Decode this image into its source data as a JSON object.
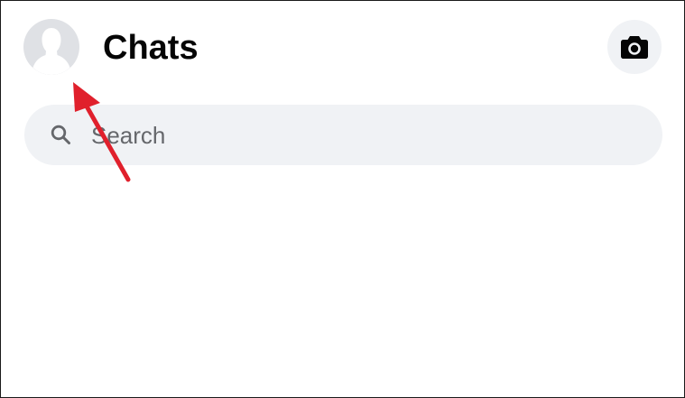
{
  "header": {
    "title": "Chats",
    "avatar_icon": "profile-avatar-icon",
    "camera_icon": "camera-icon"
  },
  "search": {
    "placeholder": "Search",
    "icon": "search-icon"
  },
  "annotation": {
    "type": "arrow",
    "color": "#e0202c",
    "points_to": "profile-avatar"
  },
  "colors": {
    "background": "#ffffff",
    "title_text": "#050505",
    "pill_background": "#f0f2f5",
    "placeholder_text": "#65676b",
    "avatar_background": "#dfe1e5",
    "avatar_silhouette": "#ffffff",
    "arrow": "#e0202c"
  }
}
